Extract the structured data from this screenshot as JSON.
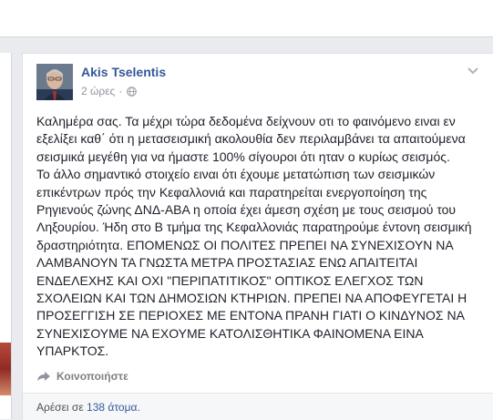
{
  "post": {
    "author": "Akis Tselentis",
    "timestamp": "2 ώρες",
    "separator": "·",
    "audience_icon": "globe-icon",
    "text_lines": [
      "Καλημέρα σας. Τα μέχρι τώρα δεδομένα δείχνουν οτι το φαινόμενο ειναι εν",
      "εξελίξει καθ΄ ότι η μετασεισμική ακολουθία δεν περιλαμβάνει τα απαιτούμενα",
      "σεισμικά μεγέθη για να ήμαστε 100% σίγουροι ότι ηταν ο κυρίως σεισμός.",
      "Το άλλο σημαντικό στοιχείο ειναι ότι έχουμε μετατώπιση των σεισμικών",
      "επικέντρων πρός την Κεφαλλονιά και παρατηρείται ενεργοποίηση της",
      "Ρηγιενούς ζώνης ΔΝΔ-ΑΒΑ η οποία έχει άμεση σχέση με τους σεισμού του",
      "Ληξουρίου. Ήδη στο Β τμήμα της Κεφαλλονιάς παρατηρούμε έντονη σεισμική",
      "δραστηριότητα. ΕΠΟΜΕΝΩΣ ΟΙ ΠΟΛΙΤΕΣ ΠΡΕΠΕΙ ΝΑ ΣΥΝΕΧΙΣΟΥΝ ΝΑ",
      "ΛΑΜΒΑΝΟΥΝ ΤΑ ΓΝΩΣΤΑ ΜΕΤΡΑ ΠΡΟΣΤΑΣΙΑΣ ΕΝΩ ΑΠΑΙΤΕΙΤΑΙ",
      "ΕΝΔΕΛΕΧΗΣ ΚΑΙ ΟΧΙ \"ΠΕΡΙΠΑΤΙΤΙΚΟΣ\" ΟΠΤΙΚΟΣ ΕΛΕΓΧΟΣ ΤΩΝ",
      "ΣΧΟΛΕΙΩΝ ΚΑΙ ΤΩΝ ΔΗΜΟΣΙΩΝ ΚΤΗΡΙΩΝ. ΠΡΕΠΕΙ ΝΑ ΑΠΟΦΕΥΓΕΤΑΙ Η",
      "ΠΡΟΣΕΓΓΙΣΗ ΣΕ ΠΕΡΙΟΧΕΣ ΜΕ ΕΝΤΟΝΑ ΠΡΑΝΗ ΓΙΑΤΙ Ο ΚΙΝΔΥΝΟΣ ΝΑ",
      "ΣΥΝΕΧΙΣΟΥΜΕ ΝΑ ΕΧΟΥΜΕ ΚΑΤΟΛΙΣΘΗΤΙΚΑ ΦΑΙΝΟΜΕΝΑ ΕΙΝΑ",
      "ΥΠΑΡΚΤΟΣ."
    ],
    "share_label": "Κοινοποιήστε",
    "likes_prefix": "Αρέσει σε",
    "likes_count": "138 άτομα",
    "likes_suffix": "."
  },
  "colors": {
    "link": "#365899",
    "background": "#e9ebee",
    "text": "#1d2129"
  }
}
